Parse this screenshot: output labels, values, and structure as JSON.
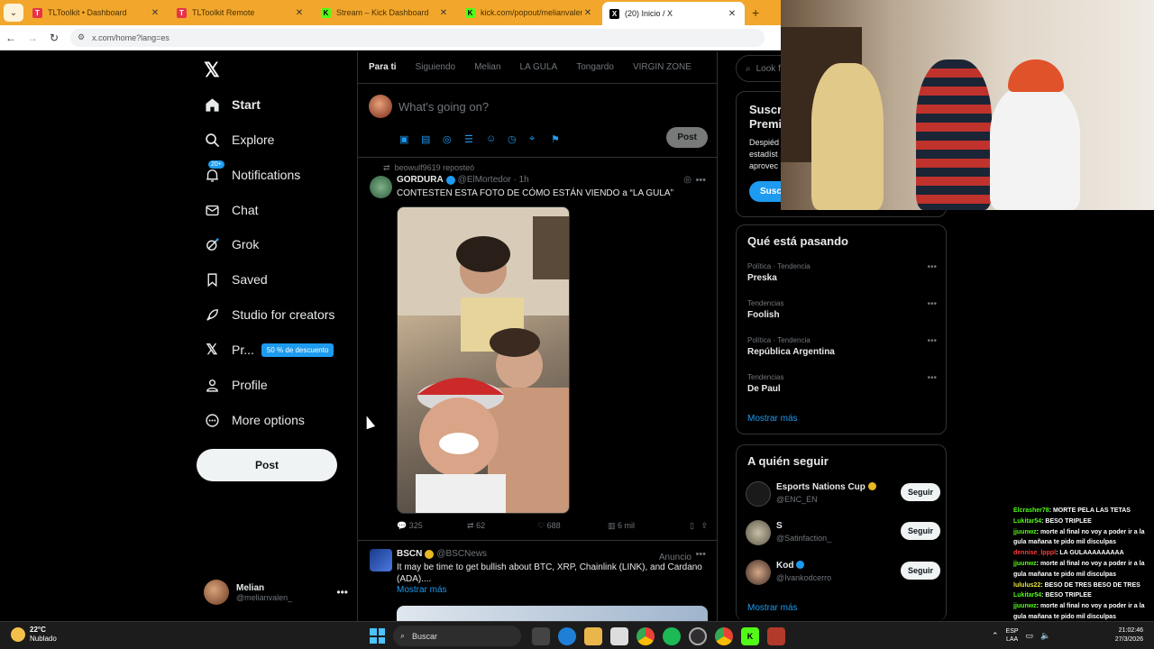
{
  "browser": {
    "tabs": [
      {
        "title": "TLToolkit • Dashboard",
        "icon": "toolkit-icon",
        "color": "#e8324a"
      },
      {
        "title": "TLToolkit Remote",
        "icon": "toolkit-icon",
        "color": "#e8324a"
      },
      {
        "title": "Stream – Kick Dashboard",
        "icon": "kick-icon",
        "color": "#53fc18"
      },
      {
        "title": "kick.com/popout/melianvalen/",
        "icon": "kick-icon",
        "color": "#53fc18"
      },
      {
        "title": "(20) Inicio / X",
        "icon": "x-icon",
        "color": "#000000"
      }
    ],
    "url": "x.com/home?lang=es"
  },
  "nav": {
    "items": [
      {
        "label": "Start",
        "icon": "home-icon"
      },
      {
        "label": "Explore",
        "icon": "search-icon"
      },
      {
        "label": "Notifications",
        "icon": "bell-icon",
        "badge": "20+"
      },
      {
        "label": "Chat",
        "icon": "mail-icon"
      },
      {
        "label": "Grok",
        "icon": "grok-icon"
      },
      {
        "label": "Saved",
        "icon": "bookmark-icon"
      },
      {
        "label": "Studio for creators",
        "icon": "rocket-icon"
      },
      {
        "label": "Pr...",
        "icon": "x-logo-icon",
        "badge": "50 % de descuento"
      },
      {
        "label": "Profile",
        "icon": "person-icon"
      },
      {
        "label": "More options",
        "icon": "more-circle-icon"
      }
    ],
    "post_label": "Post",
    "account": {
      "name": "Melian",
      "handle": "@melianvalen_"
    }
  },
  "timeline": {
    "tabs": [
      "Para ti",
      "Siguiendo",
      "Melian",
      "LA GULA",
      "Tongardo",
      "VIRGIN ZONE"
    ],
    "composer": {
      "placeholder": "What's going on?",
      "post_label": "Post"
    },
    "tweets": [
      {
        "reposted_by": "beowulf9619 reposteó",
        "name": "GORDURA",
        "handle": "@ElMortedor",
        "time": "· 1h",
        "text": "CONTESTEN ESTA FOTO DE CÓMO ESTÁN VIENDO a “LA GULA”",
        "replies": "325",
        "reposts": "62",
        "likes": "688",
        "views": "6 mil"
      },
      {
        "name": "BSCN",
        "handle": "@BSCNews",
        "ad_label": "Anuncio",
        "text": "It may be time to get bullish about BTC, XRP, Chainlink (LINK), and Cardano (ADA)....",
        "show_more": "Mostrar más"
      }
    ]
  },
  "right": {
    "search_placeholder": "Look fo",
    "premium": {
      "heading1": "Suscr",
      "heading2": "Premi",
      "desc1": "Despiéd",
      "desc2": "estadíst",
      "desc3": "aprovec",
      "button": "Susc"
    },
    "trends_title": "Qué está pasando",
    "trends": [
      {
        "category": "Política · Tendencia",
        "name": "Preska"
      },
      {
        "category": "Tendencias",
        "name": "Foolish"
      },
      {
        "category": "Política · Tendencia",
        "name": "República Argentina"
      },
      {
        "category": "Tendencias",
        "name": "De Paul"
      }
    ],
    "trends_more": "Mostrar más",
    "follow_title": "A quién seguir",
    "follow": [
      {
        "name": "Esports Nations Cup",
        "handle": "@ENC_EN",
        "button": "Seguir"
      },
      {
        "name": "S",
        "handle": "@Satinfaction_",
        "button": "Seguir"
      },
      {
        "name": "Kod",
        "handle": "@Ivankodcerro",
        "button": "Seguir"
      }
    ],
    "follow_more": "Mostrar más"
  },
  "chat": [
    {
      "user": "Elcrasher78",
      "msg": ": MORTE PELA LAS TETAS",
      "color": "green"
    },
    {
      "user": "Lukitar54",
      "msg": ": BESO TRIPLEE",
      "color": "green"
    },
    {
      "user": "jjuunwz",
      "msg": ": morte al final no voy a poder ir a la gula mañana te pido mil disculpas",
      "color": "green"
    },
    {
      "user": "dennise_lpppl",
      "msg": ": LA GULAAAAAAAAA",
      "color": "red"
    },
    {
      "user": "jjuunwz",
      "msg": ": morte al final no voy a poder ir a la gula mañana te pido mil disculpas",
      "color": "green"
    },
    {
      "user": "lululus22",
      "msg": ": BESO DE TRES BESO DE TRES",
      "color": "yellow"
    },
    {
      "user": "Lukitar54",
      "msg": ": BESO TRIPLEE",
      "color": "green"
    },
    {
      "user": "jjuunwz",
      "msg": ": morte al final no voy a poder ir a la gula mañana te pido mil disculpas",
      "color": "green"
    }
  ],
  "taskbar": {
    "weather_temp": "22°C",
    "weather_desc": "Nublado",
    "search": "Buscar",
    "lang1": "ESP",
    "lang2": "LAA",
    "time": "21:02:46",
    "date": "27/3/2026"
  }
}
